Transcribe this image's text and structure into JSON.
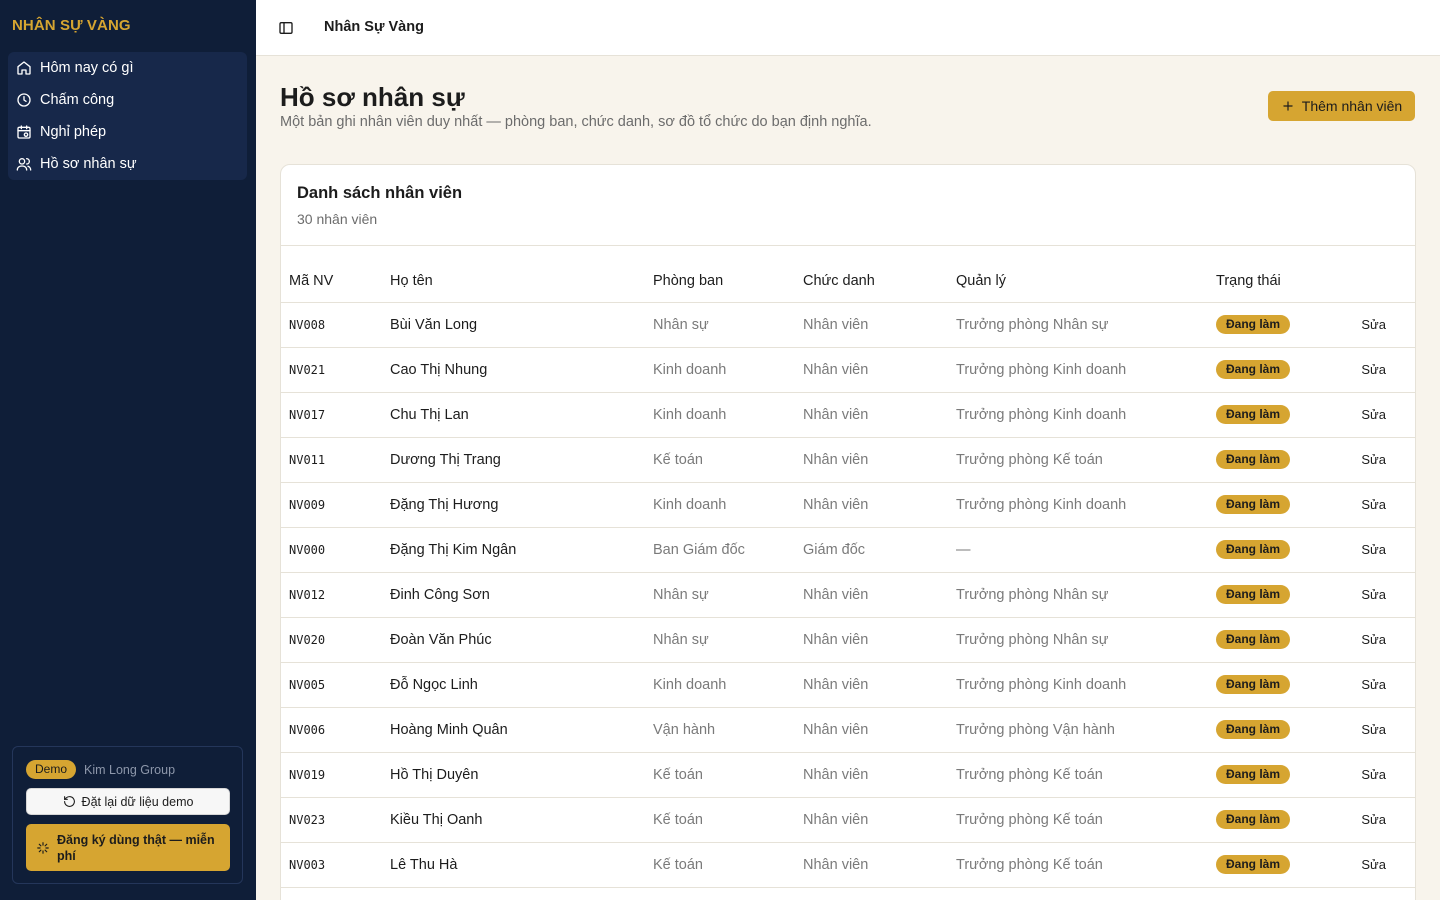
{
  "sidebar": {
    "brand": "NHÂN SỰ VÀNG",
    "items": [
      {
        "label": "Hôm nay có gì",
        "icon": "home-icon"
      },
      {
        "label": "Chấm công",
        "icon": "clock-icon"
      },
      {
        "label": "Nghỉ phép",
        "icon": "calendar-icon"
      },
      {
        "label": "Hồ sơ nhân sự",
        "icon": "users-icon"
      }
    ],
    "demo": {
      "badge": "Demo",
      "org": "Kim Long Group",
      "reset_label": "Đặt lại dữ liệu demo",
      "signup_label": "Đăng ký dùng thật — miễn phí"
    }
  },
  "topbar": {
    "title": "Nhân Sự Vàng"
  },
  "page": {
    "title": "Hồ sơ nhân sự",
    "subtitle": "Một bản ghi nhân viên duy nhất — phòng ban, chức danh, sơ đồ tổ chức do bạn định nghĩa.",
    "add_button": "Thêm nhân viên"
  },
  "card": {
    "title": "Danh sách nhân viên",
    "count": "30 nhân viên"
  },
  "table": {
    "headers": [
      "Mã NV",
      "Họ tên",
      "Phòng ban",
      "Chức danh",
      "Quản lý",
      "Trạng thái"
    ],
    "edit_label": "Sửa",
    "rows": [
      {
        "id": "NV008",
        "name": "Bùi Văn Long",
        "dept": "Nhân sự",
        "title": "Nhân viên",
        "manager": "Trưởng phòng Nhân sự",
        "status": "Đang làm"
      },
      {
        "id": "NV021",
        "name": "Cao Thị Nhung",
        "dept": "Kinh doanh",
        "title": "Nhân viên",
        "manager": "Trưởng phòng Kinh doanh",
        "status": "Đang làm"
      },
      {
        "id": "NV017",
        "name": "Chu Thị Lan",
        "dept": "Kinh doanh",
        "title": "Nhân viên",
        "manager": "Trưởng phòng Kinh doanh",
        "status": "Đang làm"
      },
      {
        "id": "NV011",
        "name": "Dương Thị Trang",
        "dept": "Kế toán",
        "title": "Nhân viên",
        "manager": "Trưởng phòng Kế toán",
        "status": "Đang làm"
      },
      {
        "id": "NV009",
        "name": "Đặng Thị Hương",
        "dept": "Kinh doanh",
        "title": "Nhân viên",
        "manager": "Trưởng phòng Kinh doanh",
        "status": "Đang làm"
      },
      {
        "id": "NV000",
        "name": "Đặng Thị Kim Ngân",
        "dept": "Ban Giám đốc",
        "title": "Giám đốc",
        "manager": "—",
        "status": "Đang làm"
      },
      {
        "id": "NV012",
        "name": "Đinh Công Sơn",
        "dept": "Nhân sự",
        "title": "Nhân viên",
        "manager": "Trưởng phòng Nhân sự",
        "status": "Đang làm"
      },
      {
        "id": "NV020",
        "name": "Đoàn Văn Phúc",
        "dept": "Nhân sự",
        "title": "Nhân viên",
        "manager": "Trưởng phòng Nhân sự",
        "status": "Đang làm"
      },
      {
        "id": "NV005",
        "name": "Đỗ Ngọc Linh",
        "dept": "Kinh doanh",
        "title": "Nhân viên",
        "manager": "Trưởng phòng Kinh doanh",
        "status": "Đang làm"
      },
      {
        "id": "NV006",
        "name": "Hoàng Minh Quân",
        "dept": "Vận hành",
        "title": "Nhân viên",
        "manager": "Trưởng phòng Vận hành",
        "status": "Đang làm"
      },
      {
        "id": "NV019",
        "name": "Hồ Thị Duyên",
        "dept": "Kế toán",
        "title": "Nhân viên",
        "manager": "Trưởng phòng Kế toán",
        "status": "Đang làm"
      },
      {
        "id": "NV023",
        "name": "Kiều Thị Oanh",
        "dept": "Kế toán",
        "title": "Nhân viên",
        "manager": "Trưởng phòng Kế toán",
        "status": "Đang làm"
      },
      {
        "id": "NV003",
        "name": "Lê Thu Hà",
        "dept": "Kế toán",
        "title": "Nhân viên",
        "manager": "Trưởng phòng Kế toán",
        "status": "Đang làm"
      }
    ]
  },
  "colors": {
    "accent": "#d6a531",
    "sidebar_bg": "#0f1e38",
    "page_bg": "#f8f4ec"
  }
}
